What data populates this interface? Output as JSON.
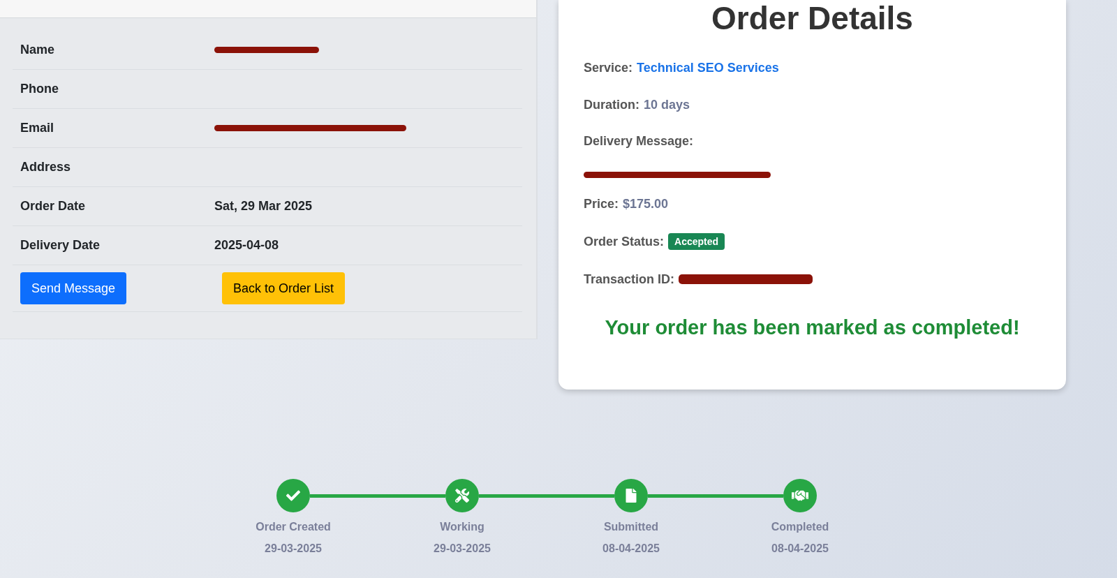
{
  "customer_panel": {
    "rows": [
      {
        "label": "Name",
        "value_redacted": true
      },
      {
        "label": "Phone"
      },
      {
        "label": "Email",
        "value_redacted": true
      },
      {
        "label": "Address"
      },
      {
        "label": "Order Date",
        "value": "Sat, 29 Mar 2025"
      },
      {
        "label": "Delivery Date",
        "value": "2025-04-08"
      }
    ],
    "buttons": [
      {
        "label": "Send Message",
        "kind": "primary"
      },
      {
        "label": "Back to Order List",
        "kind": "warning"
      }
    ]
  },
  "order_details": {
    "title": "Order Details",
    "fields": [
      {
        "label": "Service:",
        "value": "Technical SEO Services",
        "kind": "link"
      },
      {
        "label": "Duration:",
        "value": "10 days",
        "kind": "muted"
      },
      {
        "label": "Delivery Message:",
        "kind": "redacted_block"
      },
      {
        "label": "Price:",
        "value": "$175.00",
        "kind": "muted"
      },
      {
        "label": "Order Status:",
        "value": "Accepted",
        "kind": "badge"
      },
      {
        "label": "Transaction ID:",
        "kind": "redacted"
      }
    ],
    "message": "Your order has been marked as completed!"
  },
  "timeline": [
    {
      "label": "Order Created",
      "date": "29-03-2025",
      "completed": true
    },
    {
      "label": "Working",
      "date": "29-03-2025",
      "completed": true
    },
    {
      "label": "Submitted",
      "date": "08-04-2025",
      "completed": true
    },
    {
      "label": "Completed",
      "date": "08-04-2025",
      "completed": true
    }
  ]
}
